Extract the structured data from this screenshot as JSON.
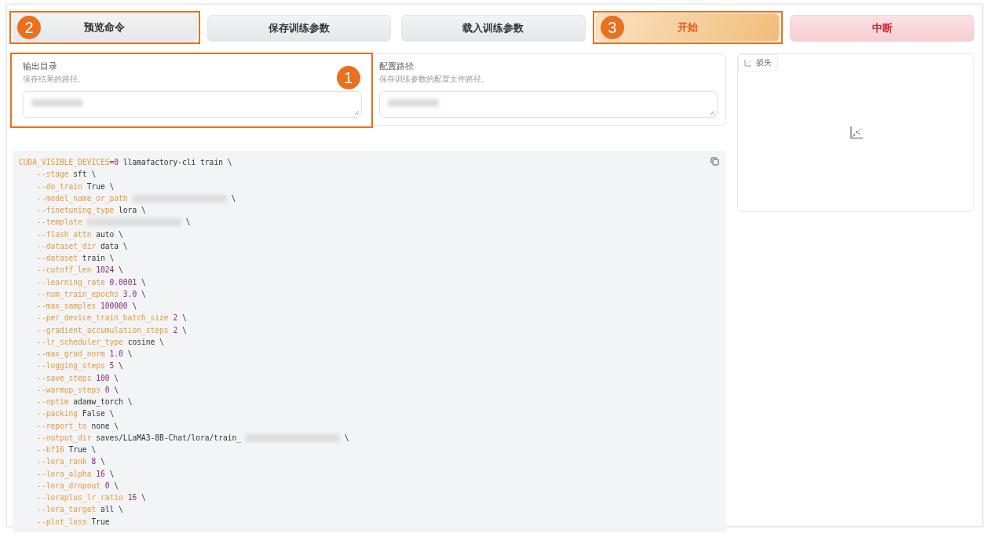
{
  "buttons": [
    {
      "label": "预览命令",
      "kind": "secondary",
      "callout": "2"
    },
    {
      "label": "保存训练参数",
      "kind": "secondary"
    },
    {
      "label": "载入训练参数",
      "kind": "secondary"
    },
    {
      "label": "开始",
      "kind": "primary",
      "callout": "3"
    },
    {
      "label": "中断",
      "kind": "stop"
    }
  ],
  "fields": [
    {
      "label": "输出目录",
      "info": "保存结果的路径。",
      "redacted": true,
      "callout": "1"
    },
    {
      "label": "配置路径",
      "info": "保存训练参数的配置文件路径。",
      "redacted": true
    }
  ],
  "command": {
    "lines": [
      [
        {
          "kind": "key",
          "text": "CUDA_VISIBLE_DEVICES"
        },
        {
          "kind": "num",
          "text": "=0"
        },
        {
          "kind": "plain",
          "text": " llamafactory-cli train \\"
        }
      ],
      [
        {
          "kind": "key",
          "text": "    --stage"
        },
        {
          "kind": "plain",
          "text": " sft \\"
        }
      ],
      [
        {
          "kind": "key",
          "text": "    --do_train"
        },
        {
          "kind": "plain",
          "text": " True \\"
        }
      ],
      [
        {
          "kind": "key",
          "text": "    --model_name_or_path"
        },
        {
          "kind": "redacted"
        },
        {
          "kind": "plain",
          "text": " \\"
        }
      ],
      [
        {
          "kind": "key",
          "text": "    --finetuning_type"
        },
        {
          "kind": "plain",
          "text": " lora \\"
        }
      ],
      [
        {
          "kind": "key",
          "text": "    --template"
        },
        {
          "kind": "redacted"
        },
        {
          "kind": "plain",
          "text": " \\"
        }
      ],
      [
        {
          "kind": "key",
          "text": "    --flash_attn"
        },
        {
          "kind": "plain",
          "text": " auto \\"
        }
      ],
      [
        {
          "kind": "key",
          "text": "    --dataset_dir"
        },
        {
          "kind": "plain",
          "text": " data \\"
        }
      ],
      [
        {
          "kind": "key",
          "text": "    --dataset"
        },
        {
          "kind": "plain",
          "text": " train \\"
        }
      ],
      [
        {
          "kind": "key",
          "text": "    --cutoff_len"
        },
        {
          "kind": "num",
          "text": " 1024"
        },
        {
          "kind": "plain",
          "text": " \\"
        }
      ],
      [
        {
          "kind": "key",
          "text": "    --learning_rate"
        },
        {
          "kind": "num",
          "text": " 0.0001"
        },
        {
          "kind": "plain",
          "text": " \\"
        }
      ],
      [
        {
          "kind": "key",
          "text": "    --num_train_epochs"
        },
        {
          "kind": "num",
          "text": " 3.0"
        },
        {
          "kind": "plain",
          "text": " \\"
        }
      ],
      [
        {
          "kind": "key",
          "text": "    --max_samples"
        },
        {
          "kind": "num",
          "text": " 100000"
        },
        {
          "kind": "plain",
          "text": " \\"
        }
      ],
      [
        {
          "kind": "key",
          "text": "    --per_device_train_batch_size"
        },
        {
          "kind": "num",
          "text": " 2"
        },
        {
          "kind": "plain",
          "text": " \\"
        }
      ],
      [
        {
          "kind": "key",
          "text": "    --gradient_accumulation_steps"
        },
        {
          "kind": "num",
          "text": " 2"
        },
        {
          "kind": "plain",
          "text": " \\"
        }
      ],
      [
        {
          "kind": "key",
          "text": "    --lr_scheduler_type"
        },
        {
          "kind": "plain",
          "text": " cosine \\"
        }
      ],
      [
        {
          "kind": "key",
          "text": "    --max_grad_norm"
        },
        {
          "kind": "num",
          "text": " 1.0"
        },
        {
          "kind": "plain",
          "text": " \\"
        }
      ],
      [
        {
          "kind": "key",
          "text": "    --logging_steps"
        },
        {
          "kind": "num",
          "text": " 5"
        },
        {
          "kind": "plain",
          "text": " \\"
        }
      ],
      [
        {
          "kind": "key",
          "text": "    --save_steps"
        },
        {
          "kind": "num",
          "text": " 100"
        },
        {
          "kind": "plain",
          "text": " \\"
        }
      ],
      [
        {
          "kind": "key",
          "text": "    --warmup_steps"
        },
        {
          "kind": "num",
          "text": " 0"
        },
        {
          "kind": "plain",
          "text": " \\"
        }
      ],
      [
        {
          "kind": "key",
          "text": "    --optim"
        },
        {
          "kind": "plain",
          "text": " adamw_torch \\"
        }
      ],
      [
        {
          "kind": "key",
          "text": "    --packing"
        },
        {
          "kind": "plain",
          "text": " False \\"
        }
      ],
      [
        {
          "kind": "key",
          "text": "    --report_to"
        },
        {
          "kind": "plain",
          "text": " none \\"
        }
      ],
      [
        {
          "kind": "key",
          "text": "    --output_dir"
        },
        {
          "kind": "plain",
          "text": " saves/LLaMA3-8B-Chat/lora/train_"
        },
        {
          "kind": "redacted"
        },
        {
          "kind": "plain",
          "text": " \\"
        }
      ],
      [
        {
          "kind": "key",
          "text": "    --bf16"
        },
        {
          "kind": "plain",
          "text": " True \\"
        }
      ],
      [
        {
          "kind": "key",
          "text": "    --lora_rank"
        },
        {
          "kind": "num",
          "text": " 8"
        },
        {
          "kind": "plain",
          "text": " \\"
        }
      ],
      [
        {
          "kind": "key",
          "text": "    --lora_alpha"
        },
        {
          "kind": "num",
          "text": " 16"
        },
        {
          "kind": "plain",
          "text": " \\"
        }
      ],
      [
        {
          "kind": "key",
          "text": "    --lora_dropout"
        },
        {
          "kind": "num",
          "text": " 0"
        },
        {
          "kind": "plain",
          "text": " \\"
        }
      ],
      [
        {
          "kind": "key",
          "text": "    --loraplus_lr_ratio"
        },
        {
          "kind": "num",
          "text": " 16"
        },
        {
          "kind": "plain",
          "text": " \\"
        }
      ],
      [
        {
          "kind": "key",
          "text": "    --lora_target"
        },
        {
          "kind": "plain",
          "text": " all \\"
        }
      ],
      [
        {
          "kind": "key",
          "text": "    --plot_loss"
        },
        {
          "kind": "plain",
          "text": " True"
        }
      ]
    ]
  },
  "plot": {
    "label": "损失"
  }
}
